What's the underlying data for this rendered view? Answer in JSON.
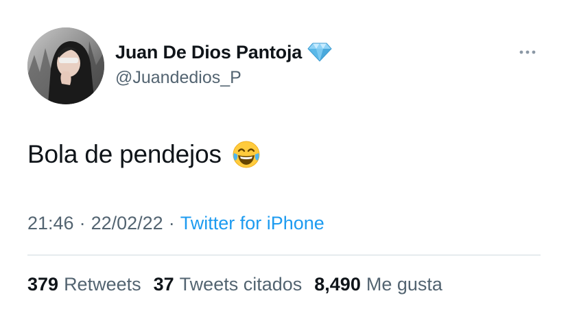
{
  "author": {
    "display_name": "Juan De Dios Pantoja",
    "handle": "@Juandedios_P",
    "verified_icon": "diamond-icon",
    "avatar": "profile-photo"
  },
  "tweet": {
    "text": "Bola de pendejos",
    "emoji": "face-with-tears-of-joy-icon"
  },
  "meta": {
    "time": "21:46",
    "separator_1": "·",
    "date": "22/02/22",
    "separator_2": "·",
    "source": "Twitter for iPhone"
  },
  "stats": {
    "retweets_value": "379",
    "retweets_label": "Retweets",
    "quotes_value": "37",
    "quotes_label": "Tweets citados",
    "likes_value": "8,490",
    "likes_label": "Me gusta"
  },
  "colors": {
    "text_primary": "#0f1419",
    "text_secondary": "#536471",
    "link": "#1d9bf0",
    "divider": "#cfd9de"
  }
}
